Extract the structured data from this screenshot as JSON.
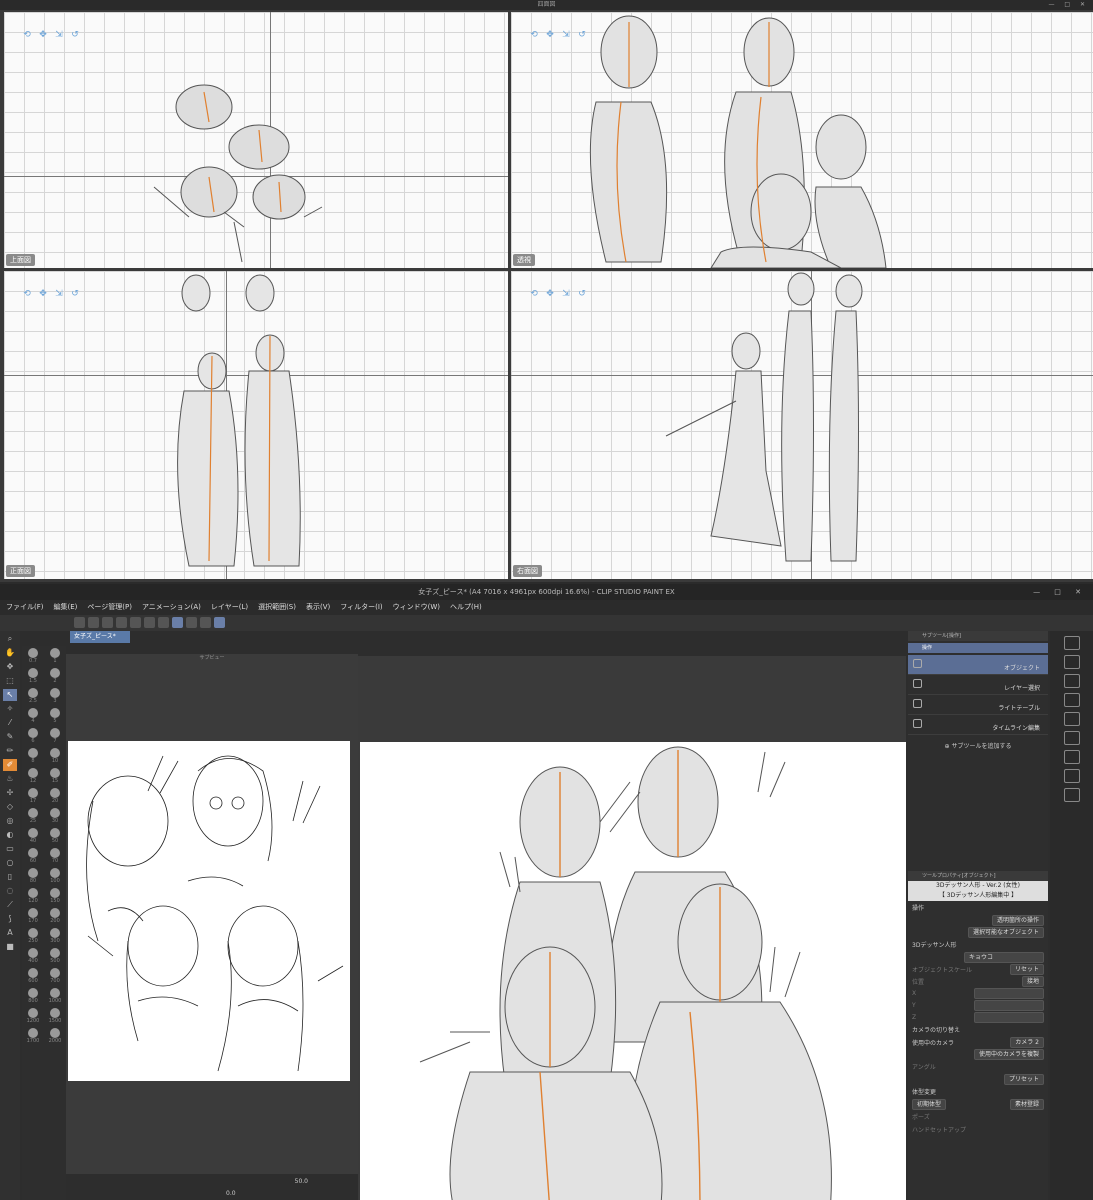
{
  "quad_viewer": {
    "title": "四面図",
    "window_controls": "— □ ✕",
    "viewports": [
      {
        "label": "上面図"
      },
      {
        "label": "透視"
      },
      {
        "label": "正面図"
      },
      {
        "label": "右面図"
      }
    ]
  },
  "app": {
    "title": "女子ズ_ピース* (A4 7016 x 4961px 600dpi 16.6%) - CLIP STUDIO PAINT EX",
    "window_controls": "— □ ✕",
    "menu": [
      "ファイル(F)",
      "編集(E)",
      "ページ管理(P)",
      "アニメーション(A)",
      "レイヤー(L)",
      "選択範囲(S)",
      "表示(V)",
      "フィルター(I)",
      "ウィンドウ(W)",
      "ヘルプ(H)"
    ],
    "doc_tab": "女子ズ_ピース*",
    "subview": {
      "header": "サブビュー",
      "zoom": "50.0",
      "rotation": "0.0"
    },
    "brush_sizes": [
      "0.7",
      "1",
      "1.5",
      "2",
      "2.5",
      "3",
      "4",
      "5",
      "6",
      "7",
      "8",
      "10",
      "12",
      "15",
      "17",
      "20",
      "25",
      "30",
      "40",
      "50",
      "60",
      "70",
      "80",
      "100",
      "120",
      "150",
      "170",
      "200",
      "250",
      "300",
      "400",
      "500",
      "600",
      "700",
      "800",
      "1000",
      "1200",
      "1500",
      "1700",
      "2000"
    ],
    "subtool_panel": {
      "header": "サブツール[操作]",
      "group": "操作",
      "items": [
        "オブジェクト",
        "レイヤー選択",
        "ライトテーブル",
        "タイムライン編集"
      ],
      "add_label": "サブツールを追加する"
    },
    "tool_property": {
      "header": "ツールプロパティ[オブジェクト]",
      "model_name": "3Dデッサン人形 - Ver.2 (女性)",
      "banner": "【 3Dデッサン人形編集中 】",
      "section_operation": "操作",
      "transparent_op": "透明箇所の操作",
      "selectable_obj": "選択可能なオブジェクト",
      "section_model": "3Dデッサン人形",
      "character_name": "キョウコ",
      "object_scale": "オブジェクトスケール",
      "reset": "リセット",
      "position": "位置",
      "ground": "接地",
      "axis_x": "X",
      "axis_y": "Y",
      "axis_z": "Z",
      "camera_switch": "カメラの切り替え",
      "camera_in_use": "使用中のカメラ",
      "camera_value": "カメラ 2",
      "duplicate_camera": "使用中のカメラを複製",
      "angle": "アングル",
      "preset": "プリセット",
      "body_change": "体型変更",
      "initial_body": "初期体型",
      "register_material": "素材登録",
      "pose": "ポーズ",
      "hand_setup": "ハンドセットアップ"
    }
  }
}
